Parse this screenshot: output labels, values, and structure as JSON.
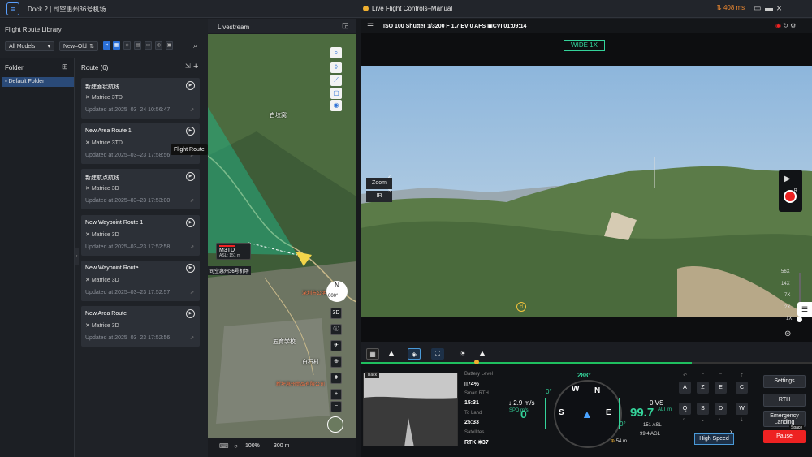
{
  "titlebar": {
    "logo": "≡",
    "title": "Dock 2 | 司空惠州36号机场",
    "mode": "Live Flight Controls–Manual",
    "latency": "408 ms",
    "icons": [
      "latency-icon",
      "monitor-icon",
      "minimize-icon",
      "close-icon"
    ]
  },
  "library": {
    "title": "Flight Route Library",
    "model_filter": "All Models",
    "sort": "New–Old",
    "folder_header": "Folder",
    "folder_item": "Default Folder",
    "route_header": "Route (6)",
    "tooltip": "Flight Route",
    "routes": [
      {
        "name": "新建面状航线",
        "model": "Matrice 3TD",
        "updated": "Updated at 2025–03–24 10:56:47"
      },
      {
        "name": "New Area Route 1",
        "model": "Matrice 3TD",
        "updated": "Updated at 2025–03–23 17:58:56"
      },
      {
        "name": "新建航点航线",
        "model": "Matrice 3D",
        "updated": "Updated at 2025–03–23 17:53:00"
      },
      {
        "name": "New Waypoint Route 1",
        "model": "Matrice 3D",
        "updated": "Updated at 2025–03–23 17:52:58"
      },
      {
        "name": "New Waypoint Route",
        "model": "Matrice 3D",
        "updated": "Updated at 2025–03–23 17:52:57"
      },
      {
        "name": "New Area Route",
        "model": "Matrice 3D",
        "updated": "Updated at 2025–03–23 17:52:56"
      }
    ]
  },
  "map": {
    "title": "Livestream",
    "places": [
      "白坟窝",
      "五育学校",
      "白石村",
      "深圳市公明学校",
      "新坪惠州尚品有限公司"
    ],
    "drone_name": "M3TD",
    "drone_asl": "ASL: 151 m",
    "dock_label": "司空惠州36号机场",
    "compass_n": "N",
    "compass_deg": "000°",
    "btn_3d": "3D",
    "btn_plus": "+",
    "btn_minus": "−",
    "zoom": "100%",
    "scale": "300 m"
  },
  "camera": {
    "stats": "ISO 100   Shutter 1/3200   F 1.7   EV 0    AFS    ▣CVI  01:09:14",
    "lens_mode": "WIDE 1X",
    "lens_zoom": "Zoom",
    "lens_ir": "IR",
    "lens_badge_zoom": "2",
    "lens_badge_ir": "3",
    "rec_badge": "R",
    "zoom_levels": [
      "56X",
      "14X",
      "7X",
      "2X",
      "1X"
    ],
    "poi": "H"
  },
  "telemetry": {
    "pip_label": "Back",
    "battery_label": "Battery Level",
    "battery_val": "74%",
    "smart_rth_label": "Smart RTH",
    "smart_rth_val": "15:31",
    "to_land_label": "To Land",
    "to_land_val": "25:33",
    "satellites_label": "Satellites",
    "satellites_val": "RTK ⛯37",
    "heading": "288°",
    "hspeed": "↓ 2.9 m/s",
    "spd_label": "SPD m/s",
    "spd_val": "0",
    "speed_zero": "0°",
    "vs": "0 VS",
    "alt_val": "99.7",
    "alt_unit": "ALT m",
    "asl": "151 ASL",
    "agl": "99.4 AGL",
    "alt_zero": "0°",
    "dist": "54 m",
    "hsi_dirs": [
      "N",
      "W",
      "S",
      "E"
    ]
  },
  "keys": {
    "row1": [
      "A",
      "Z",
      "E",
      "C"
    ],
    "row2": [
      "Q",
      "S",
      "D",
      "W"
    ]
  },
  "controls": {
    "high_speed": "High Speed",
    "settings": "Settings",
    "rth": "RTH",
    "emergency": "Emergency Landing",
    "pause": "Pause",
    "space": "Space"
  },
  "colors": {
    "accent": "#2a6fd6",
    "green": "#34d39a",
    "record": "#ee2222",
    "warning": "#f08a30"
  }
}
